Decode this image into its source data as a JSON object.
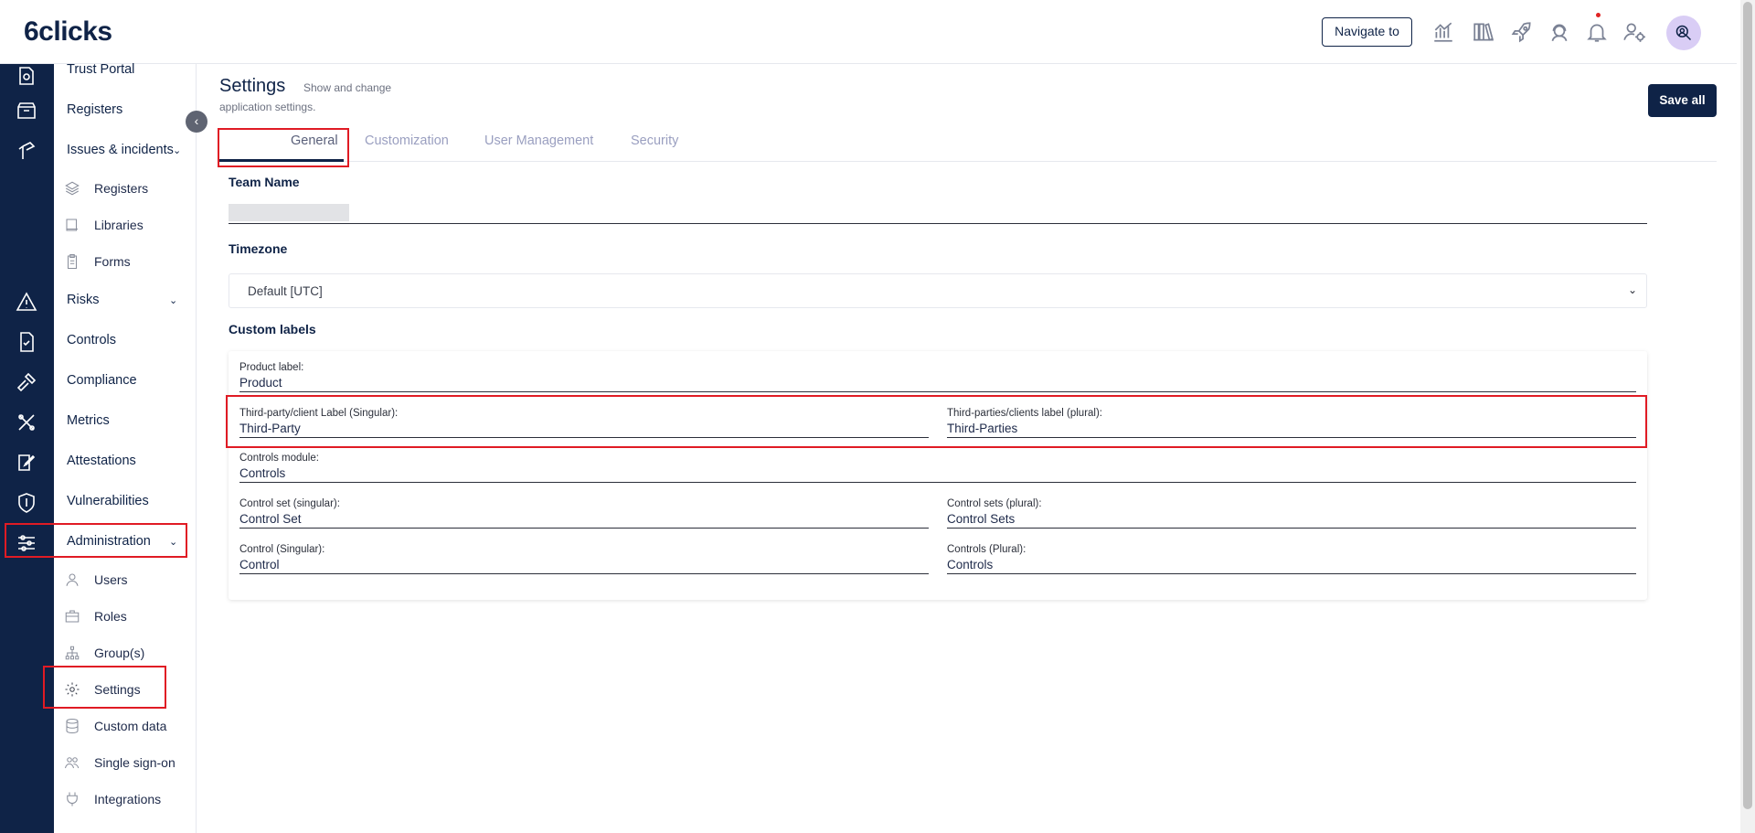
{
  "header": {
    "logo": "6clicks",
    "navigate_label": "Navigate to",
    "icons": [
      "analytics-icon",
      "library-icon",
      "rocket-icon",
      "support-icon",
      "bell-icon",
      "user-settings-icon",
      "avatar-search-icon"
    ]
  },
  "sidebar": {
    "items": [
      {
        "label": "Trust Portal"
      },
      {
        "label": "Registers"
      },
      {
        "label": "Issues & incidents"
      },
      {
        "label": "Risks"
      },
      {
        "label": "Controls"
      },
      {
        "label": "Compliance"
      },
      {
        "label": "Metrics"
      },
      {
        "label": "Attestations"
      },
      {
        "label": "Vulnerabilities"
      },
      {
        "label": "Administration"
      }
    ],
    "issues_sub": [
      {
        "label": "Registers"
      },
      {
        "label": "Libraries"
      },
      {
        "label": "Forms"
      }
    ],
    "admin_sub": [
      {
        "label": "Users"
      },
      {
        "label": "Roles"
      },
      {
        "label": "Group(s)"
      },
      {
        "label": "Settings"
      },
      {
        "label": "Custom data"
      },
      {
        "label": "Single sign-on"
      },
      {
        "label": "Integrations"
      }
    ]
  },
  "page": {
    "title": "Settings",
    "subtitle_1": "Show and change",
    "subtitle_2": "application settings.",
    "save_label": "Save all"
  },
  "tabs": [
    {
      "label": "General",
      "active": true
    },
    {
      "label": "Customization"
    },
    {
      "label": "User Management"
    },
    {
      "label": "Security"
    }
  ],
  "general": {
    "team_name_label": "Team Name",
    "team_name_value": "",
    "timezone_label": "Timezone",
    "timezone_value": "Default [UTC]",
    "custom_labels_heading": "Custom labels"
  },
  "custom_labels": {
    "product_label": "Product label:",
    "product_value": "Product",
    "third_party_singular_label": "Third-party/client Label (Singular):",
    "third_party_singular_value": "Third-Party",
    "third_party_plural_label": "Third-parties/clients label (plural):",
    "third_party_plural_value": "Third-Parties",
    "controls_module_label": "Controls module:",
    "controls_module_value": "Controls",
    "control_set_singular_label": "Control set (singular):",
    "control_set_singular_value": "Control Set",
    "control_set_plural_label": "Control sets (plural):",
    "control_set_plural_value": "Control Sets",
    "control_singular_label": "Control (Singular):",
    "control_singular_value": "Control",
    "control_plural_label": "Controls (Plural):",
    "control_plural_value": "Controls"
  },
  "colors": {
    "brand_navy": "#0f2347",
    "highlight_red": "#e01b24",
    "avatar_bg": "#d9cdf5"
  }
}
